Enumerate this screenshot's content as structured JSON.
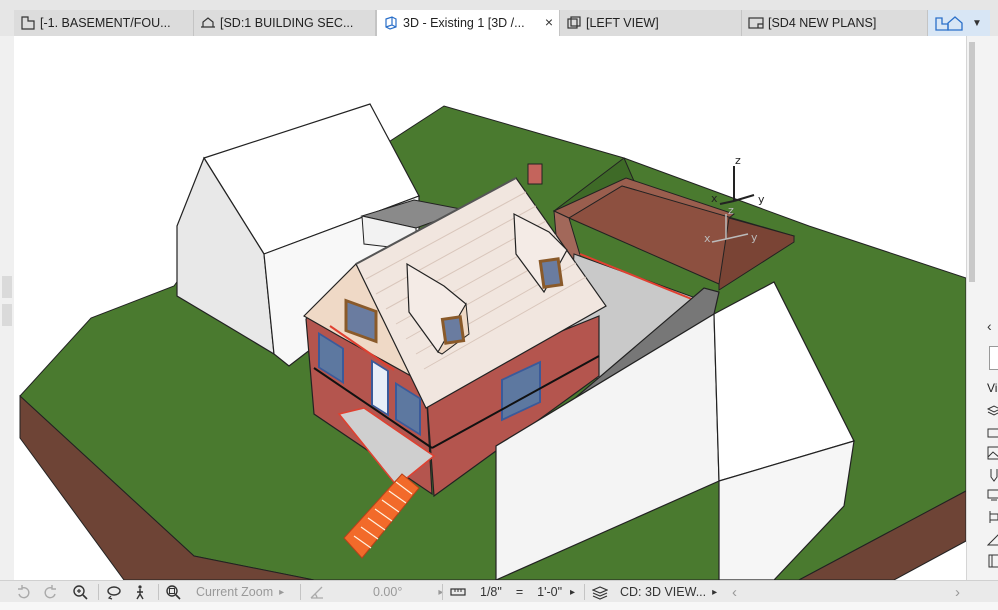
{
  "tabs": [
    {
      "label": "[-1. BASEMENT/FOU...",
      "icon": "floor-plan-icon",
      "active": false
    },
    {
      "label": "[SD:1 BUILDING SEC...",
      "icon": "section-icon",
      "active": false
    },
    {
      "label": "3D - Existing 1 [3D /...",
      "icon": "3d-view-icon",
      "active": true,
      "close": "×"
    },
    {
      "label": "[LEFT VIEW]",
      "icon": "elevation-icon",
      "active": false
    },
    {
      "label": "[SD4 NEW PLANS]",
      "icon": "layout-icon",
      "active": false
    }
  ],
  "axis_gizmo": {
    "z": "z",
    "x": "x",
    "y": "y"
  },
  "right_panel": {
    "label": "Vi",
    "collapse": "‹"
  },
  "statusbar": {
    "zoom_label": "Current Zoom",
    "angle_value": "0.00°",
    "scale_value": "1/8\"",
    "equals": "=",
    "scale_units": "1'-0\"",
    "view_label": "CD: 3D VIEW...",
    "caret": "▸",
    "nav_prev": "‹",
    "nav_next": "›"
  },
  "colors": {
    "grass": "#4a7a2f",
    "earth": "#7a4a3a",
    "brick": "#b4554e",
    "roof": "#f0e5de",
    "accent_red": "#e04030",
    "stairs": "#f26a2a",
    "massing": "#ffffff",
    "tab_active": "#ffffff",
    "tab_inactive": "#dcdcdc"
  }
}
